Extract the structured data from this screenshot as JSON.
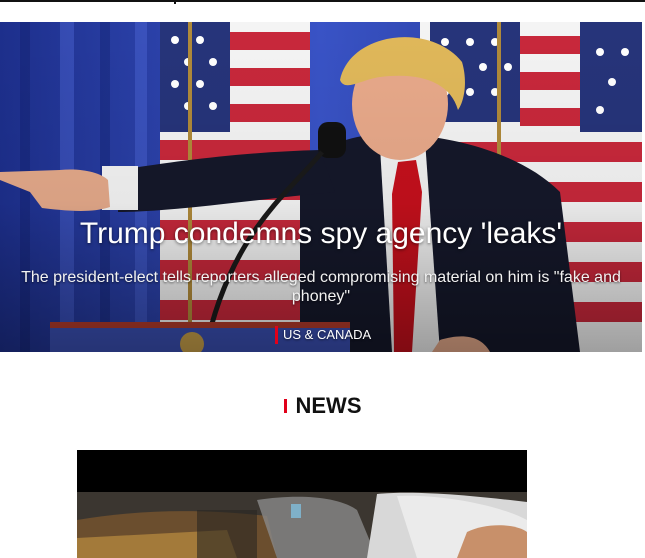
{
  "hero": {
    "headline": "Trump condemns spy agency 'leaks'",
    "summary": "The president-elect tells reporters alleged compromising material on him is \"fake and phoney\"",
    "section": "US & CANADA"
  },
  "news_section": {
    "title": "NEWS"
  },
  "colors": {
    "accent": "#e1001a",
    "text": "#111111",
    "background": "#ffffff"
  }
}
